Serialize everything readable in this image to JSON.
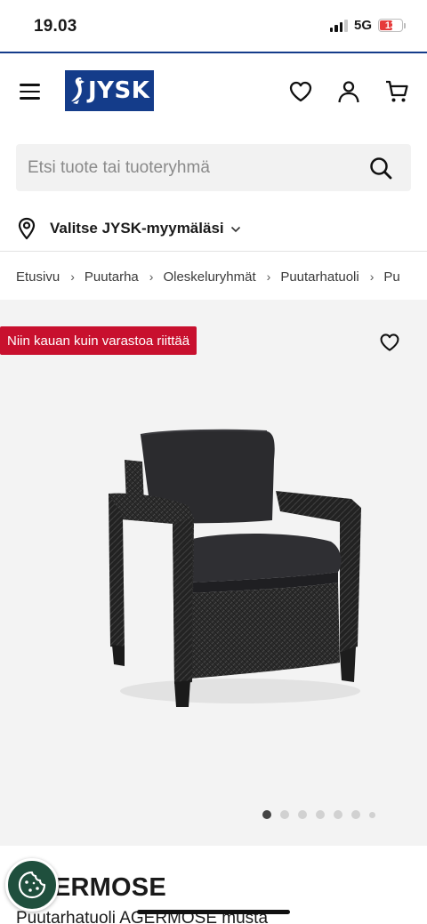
{
  "status_bar": {
    "time": "19.03",
    "network": "5G",
    "battery": "13",
    "battery_level": 0.13
  },
  "header": {
    "brand": "JYSK",
    "icons": [
      "menu-icon",
      "heart-icon",
      "user-icon",
      "cart-icon"
    ]
  },
  "search": {
    "placeholder": "Etsi tuote tai tuoteryhmä",
    "value": ""
  },
  "store": {
    "label": "Valitse JYSK-myymäläsi"
  },
  "breadcrumb": [
    "Etusivu",
    "Puutarha",
    "Oleskeluryhmät",
    "Puutarhatuoli",
    "Pu"
  ],
  "product": {
    "badge": "Niin kauan kuin varastoa riittää",
    "title": "AGERMOSE",
    "title_visible": "ERMOSE",
    "subtitle": "Puutarhatuoli AGERMOSE musta",
    "image_count": 7,
    "active_image": 1
  },
  "colors": {
    "brand_blue": "#143c8a",
    "badge_red": "#c8102e",
    "cookie_green": "#1f4f3d"
  }
}
